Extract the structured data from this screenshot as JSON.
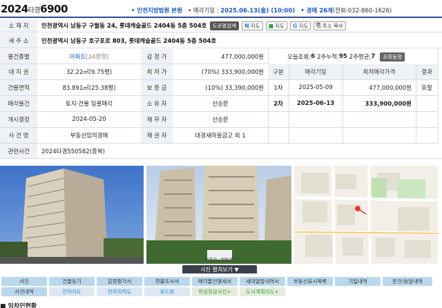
{
  "header": {
    "case_year": "2024",
    "case_type": "타경",
    "case_num": "6900",
    "court": "• 인천지방법원 본원",
    "sale_date_label": "• 매각기일 :",
    "sale_date": "2025.06.13(金) (10:00)",
    "dept": "• 경매 26계",
    "phone": "(전화:032-860-1626)"
  },
  "address": {
    "label": "소 재 지",
    "value": "인천광역시 남동구 구월동 24, 롯데캐슬골드 2404동 5층 504호",
    "road_btn": "도로명검색",
    "map1": "지도",
    "map2": "지도",
    "map3": "지도",
    "copy": "주소 복사"
  },
  "new_address": {
    "label": "새 주 소",
    "value": "인천광역시 남동구 호구포로 803, 롯데캐슬골드 2404동 5층 504호"
  },
  "info": {
    "type_label": "물건종별",
    "type_value": "아파트",
    "type_size": "[34평형]",
    "land_label": "대 지 권",
    "land_value": "32.22㎡(9.75평)",
    "bldg_label": "건물면적",
    "bldg_value": "83.891㎡(25.38평)",
    "sale_label": "매각물건",
    "sale_value": "토지·건물 일괄매각",
    "open_label": "개시결정",
    "open_value": "2024-05-20",
    "case_label": "사 건 명",
    "case_value": "부동산임의경매",
    "appraisal_label": "감 정 가",
    "appraisal_value": "477,000,000원",
    "min_label": "최 저 가",
    "min_value": "(70%) 333,900,000원",
    "deposit_label": "보 증 금",
    "deposit_value": "(10%) 33,390,000원",
    "owner_label": "소 유 자",
    "owner_value": "신승문",
    "debtor_label": "채 무 자",
    "debtor_value": "신승문",
    "creditor_label": "채 권 자",
    "creditor_value": "대경새마을금고 외 1",
    "related_label": "관련사건",
    "related_value": "2024타경550582(중복)"
  },
  "stats": {
    "today_label": "오늘조회:",
    "today": "6",
    "week2_label": "2주누적:",
    "week2": "95",
    "avg_label": "2주평균:",
    "avg": "7",
    "trend_btn": "조회동향"
  },
  "history": {
    "headers": [
      "구분",
      "매각기일",
      "최저매각가격",
      "결과"
    ],
    "rows": [
      {
        "round": "1차",
        "date": "2025-05-09",
        "price": "477,000,000원",
        "result": "유찰"
      },
      {
        "round": "2차",
        "date": "2025-06-13",
        "price": "333,900,000원",
        "result": ""
      }
    ]
  },
  "photos": {
    "expand_btn": "사진 펼쳐보기 ▼",
    "caption": "사진출처 : 법원경매"
  },
  "nav": {
    "row1": [
      "사진",
      "건물등기",
      "감정평가서",
      "현황조사서",
      "매각물건명세서",
      "세대열람내역서",
      "부동산표시목록",
      "기일내역",
      "문건/송달내역"
    ],
    "row2": [
      "사건내역",
      "전자지도",
      "전자지적도",
      "로드뷰",
      "위성항공사진+",
      "도시계획지도+"
    ]
  },
  "footer": {
    "title": "■ 임차인현황"
  },
  "colors": {
    "accent": "#1a56c4",
    "header_border": "#2f4b8f",
    "label_bg": "#eef1f6",
    "nav_btn": "#b9d8ec"
  }
}
